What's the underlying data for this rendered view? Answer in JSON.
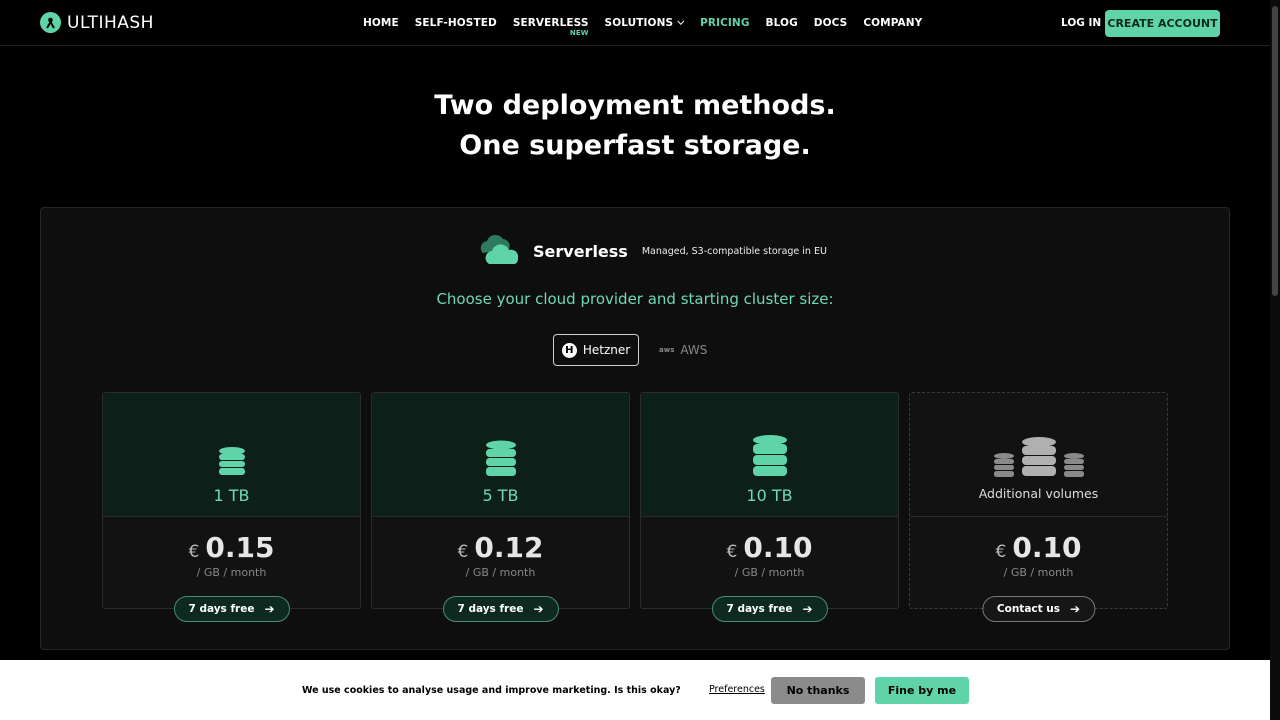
{
  "brand": {
    "name": "ULTIHASH",
    "accent": "#5fd4a8"
  },
  "nav": {
    "items": [
      {
        "label": "HOME"
      },
      {
        "label": "SELF-HOSTED"
      },
      {
        "label": "SERVERLESS",
        "badge": "NEW"
      },
      {
        "label": "SOLUTIONS"
      },
      {
        "label": "PRICING",
        "active": true
      },
      {
        "label": "BLOG"
      },
      {
        "label": "DOCS"
      },
      {
        "label": "COMPANY"
      }
    ],
    "login": "LOG IN",
    "create_account": "CREATE ACCOUNT"
  },
  "hero": {
    "line1": "Two deployment methods.",
    "line2": "One superfast storage."
  },
  "service": {
    "title": "Serverless",
    "subtitle": "Managed, S3-compatible storage in EU",
    "choose": "Choose your cloud provider and starting cluster size:",
    "providers": [
      {
        "label": "Hetzner",
        "selected": true
      },
      {
        "label": "AWS",
        "selected": false
      }
    ]
  },
  "cards": [
    {
      "size": "1 TB",
      "currency": "€",
      "price": "0.15",
      "unit": "/ GB / month",
      "cta": "7 days free"
    },
    {
      "size": "5 TB",
      "currency": "€",
      "price": "0.12",
      "unit": "/ GB / month",
      "cta": "7 days free"
    },
    {
      "size": "10 TB",
      "currency": "€",
      "price": "0.10",
      "unit": "/ GB / month",
      "cta": "7 days free"
    },
    {
      "size": "Additional volumes",
      "currency": "€",
      "price": "0.10",
      "unit": "/ GB / month",
      "cta": "Contact us"
    }
  ],
  "cookie": {
    "text": "We use cookies to analyse usage and improve marketing. Is this okay?",
    "preferences": "Preferences",
    "no": "No thanks",
    "yes": "Fine by me"
  }
}
